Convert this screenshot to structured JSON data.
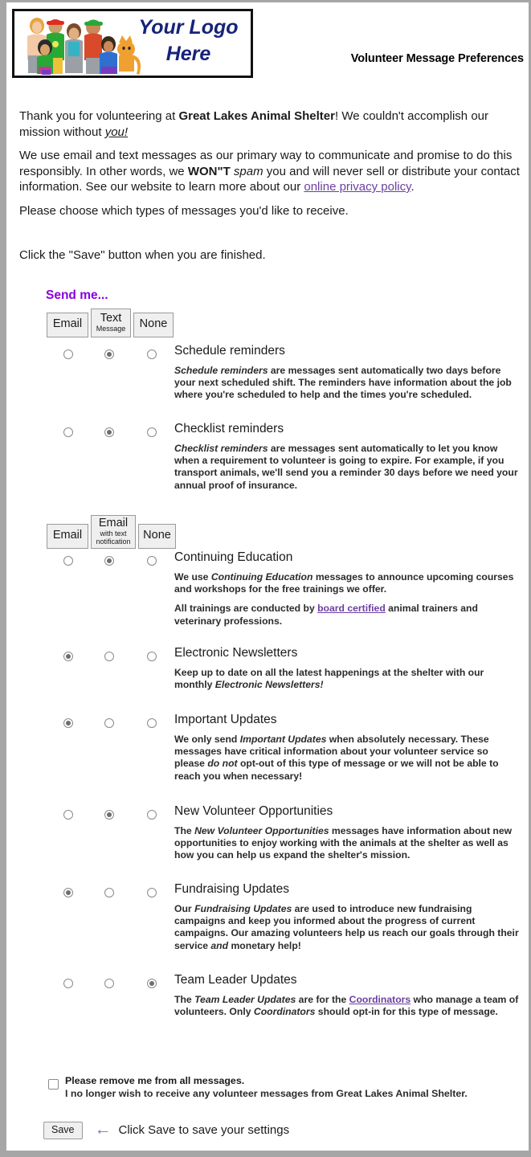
{
  "header": {
    "logo_line1": "Your Logo",
    "logo_line2": "Here",
    "title": "Volunteer Message Preferences"
  },
  "intro": {
    "p1_a": "Thank you for volunteering at ",
    "p1_org": "Great Lakes Animal Shelter",
    "p1_b": "! We couldn't accomplish our mission without ",
    "p1_you": "you!",
    "p2_a": "We use email and text messages as our primary way to communicate and promise to do this responsibly. In other words, we ",
    "p2_wont": "WON\"T",
    "p2_spam": " spam",
    "p2_b": " you and will never sell or distribute your contact information. See our website to learn more about our ",
    "p2_link": "online privacy policy",
    "p2_c": ".",
    "p3": "Please choose which types of messages you'd like to receive.",
    "click_save": "Click the \"Save\" button when you are finished."
  },
  "send_me_heading": "Send me...",
  "column_headers_1": [
    {
      "big": "Email",
      "small": ""
    },
    {
      "big": "Text",
      "small": "Message"
    },
    {
      "big": "None",
      "small": ""
    }
  ],
  "column_headers_2": [
    {
      "big": "Email",
      "small": ""
    },
    {
      "big": "Email",
      "small": "with text notification"
    },
    {
      "big": "None",
      "small": ""
    }
  ],
  "group1": [
    {
      "title": "Schedule reminders",
      "selected": 1,
      "paragraphs": [
        {
          "parts": [
            {
              "text": "Schedule reminders",
              "style": "i"
            },
            {
              "text": " are messages sent automatically two days before your next scheduled shift. The reminders have information about the job where you're scheduled to help and the times you're scheduled.",
              "style": ""
            }
          ]
        }
      ]
    },
    {
      "title": "Checklist reminders",
      "selected": 1,
      "paragraphs": [
        {
          "parts": [
            {
              "text": "Checklist reminders",
              "style": "i"
            },
            {
              "text": " are messages sent automatically to let you know when a requirement to volunteer is going to expire. For example, if you transport animals, we'll send you a reminder 30 days before we need your annual proof of insurance.",
              "style": ""
            }
          ]
        }
      ]
    }
  ],
  "group2": [
    {
      "title": "Continuing Education",
      "selected": 1,
      "paragraphs": [
        {
          "parts": [
            {
              "text": "We use ",
              "style": ""
            },
            {
              "text": "Continuing Education",
              "style": "i"
            },
            {
              "text": " messages to announce upcoming courses and workshops for the free trainings we offer.",
              "style": ""
            }
          ]
        },
        {
          "parts": [
            {
              "text": "All trainings are conducted by ",
              "style": ""
            },
            {
              "text": "board certified",
              "style": "link"
            },
            {
              "text": " animal trainers and veterinary professions.",
              "style": ""
            }
          ]
        }
      ]
    },
    {
      "title": "Electronic Newsletters",
      "selected": 0,
      "paragraphs": [
        {
          "parts": [
            {
              "text": "Keep up to date on all the latest happenings at the shelter with our monthly ",
              "style": ""
            },
            {
              "text": "Electronic Newsletters!",
              "style": "i"
            }
          ]
        }
      ]
    },
    {
      "title": "Important Updates",
      "selected": 0,
      "paragraphs": [
        {
          "parts": [
            {
              "text": "We only send ",
              "style": ""
            },
            {
              "text": "Important Updates",
              "style": "i"
            },
            {
              "text": " when ",
              "style": ""
            },
            {
              "text": "absolutely",
              "style": "b"
            },
            {
              "text": " necessary. These messages have critical information about your volunteer service so please ",
              "style": ""
            },
            {
              "text": "do not",
              "style": "bi"
            },
            {
              "text": " opt-out of this type of message or we will not be able to reach you when necessary!",
              "style": ""
            }
          ]
        }
      ]
    },
    {
      "title": "New Volunteer Opportunities",
      "selected": 1,
      "paragraphs": [
        {
          "parts": [
            {
              "text": "The ",
              "style": ""
            },
            {
              "text": "New Volunteer Opportunities",
              "style": "i"
            },
            {
              "text": " messages have information about new opportunities to enjoy working with the animals at the shelter as well as how you can help us expand the shelter's mission.",
              "style": ""
            }
          ]
        }
      ]
    },
    {
      "title": "Fundraising Updates",
      "selected": 0,
      "paragraphs": [
        {
          "parts": [
            {
              "text": "Our ",
              "style": ""
            },
            {
              "text": "Fundraising Updates",
              "style": "i"
            },
            {
              "text": " are used to introduce new fundraising campaigns and keep you informed about the progress of current campaigns. Our ",
              "style": ""
            },
            {
              "text": "amazing",
              "style": "b"
            },
            {
              "text": " volunteers help us reach our goals through their service ",
              "style": ""
            },
            {
              "text": "and",
              "style": "i"
            },
            {
              "text": " monetary help!",
              "style": ""
            }
          ]
        }
      ]
    },
    {
      "title": "Team Leader Updates",
      "selected": 2,
      "paragraphs": [
        {
          "parts": [
            {
              "text": "The ",
              "style": ""
            },
            {
              "text": "Team Leader Updates",
              "style": "i"
            },
            {
              "text": " are for the ",
              "style": ""
            },
            {
              "text": "Coordinators",
              "style": "link"
            },
            {
              "text": " who manage a team of volunteers. ",
              "style": ""
            },
            {
              "text": "Only ",
              "style": "b"
            },
            {
              "text": "Coordinators",
              "style": "bi"
            },
            {
              "text": " should opt-in for this type of message.",
              "style": "b"
            }
          ]
        }
      ]
    }
  ],
  "optout": {
    "checked": false,
    "line1": "Please remove me from all messages.",
    "line2": "I no longer wish to receive any volunteer messages from Great Lakes Animal Shelter."
  },
  "footer": {
    "save_label": "Save",
    "arrow": "←",
    "hint": "Click Save to save your settings"
  },
  "colors": {
    "heading_purple": "#8800dd",
    "link_purple": "#6b3fa0",
    "logo_navy": "#16237a",
    "arrow_blue": "#6f6fd8"
  }
}
